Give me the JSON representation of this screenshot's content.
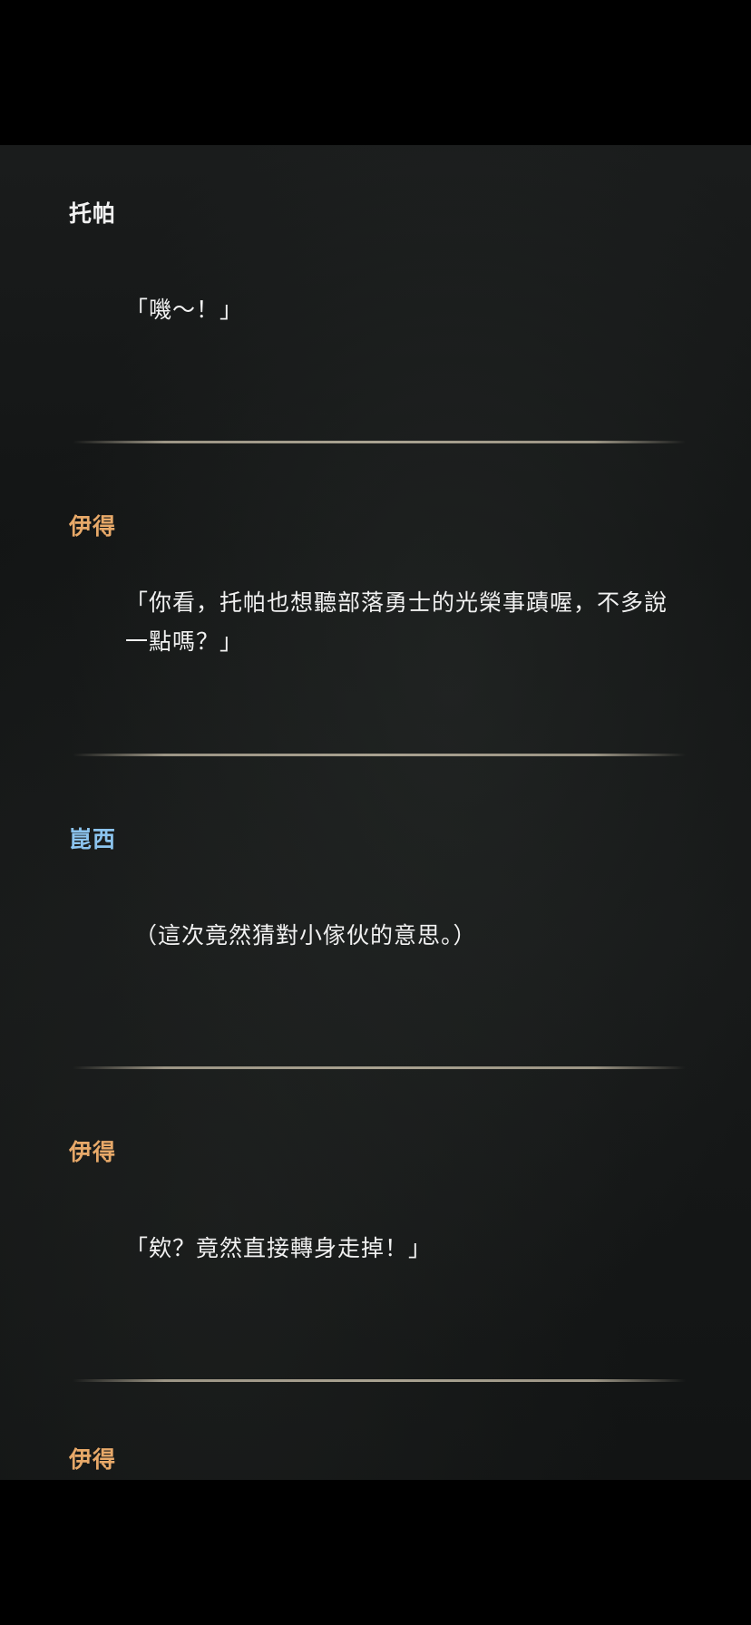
{
  "colors": {
    "name_white": "#f1f1f1",
    "name_orange": "#e8a969",
    "name_blue": "#8cc4ee",
    "text": "#f1f1f1"
  },
  "entries": [
    {
      "speaker": "托帕",
      "speaker_color": "#f1f1f1",
      "text": "「嘰～！」"
    },
    {
      "speaker": "伊得",
      "speaker_color": "#e8a969",
      "text": "「你看，托帕也想聽部落勇士的光榮事蹟喔，不多說一點嗎？」"
    },
    {
      "speaker": "崑西",
      "speaker_color": "#8cc4ee",
      "text": "（這次竟然猜對小傢伙的意思。）"
    },
    {
      "speaker": "伊得",
      "speaker_color": "#e8a969",
      "text": "「欸？竟然直接轉身走掉！」"
    }
  ],
  "partial_entry": {
    "speaker": "伊得",
    "speaker_color": "#e8a969"
  },
  "back_button": {
    "icon": "undo-arrow-icon"
  }
}
